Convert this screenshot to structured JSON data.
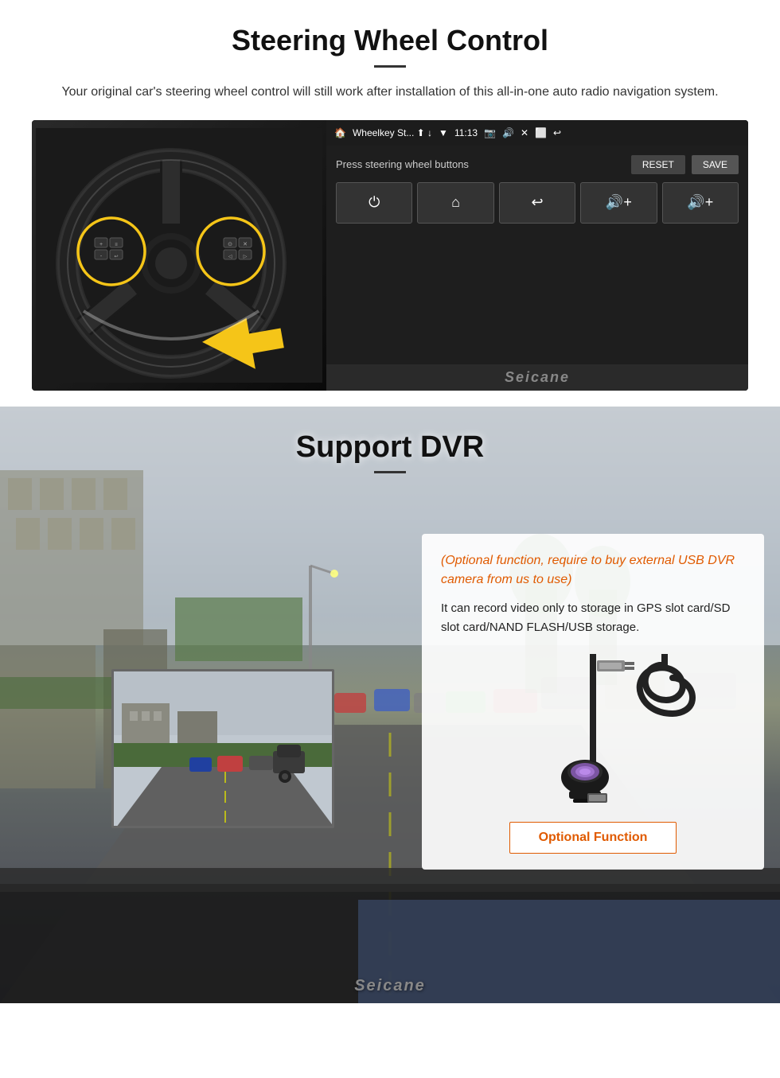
{
  "steering": {
    "title": "Steering Wheel Control",
    "subtitle": "Your original car's steering wheel control will still work after installation of this all-in-one auto radio navigation system.",
    "statusBar": {
      "appName": "Wheelkey St... ⬆ ↓",
      "time": "11:13",
      "icons": "📷 🔊 ✕ ⬜ ↩"
    },
    "wheelkeyUI": {
      "label": "Press steering wheel buttons",
      "resetBtn": "RESET",
      "saveBtn": "SAVE",
      "controls": [
        "⏻",
        "⌂",
        "↩",
        "🔊+",
        "🔊+"
      ]
    },
    "watermark": "Seicane"
  },
  "dvr": {
    "title": "Support DVR",
    "optionalText": "(Optional function, require to buy external USB DVR camera from us to use)",
    "bodyText": "It can record video only to storage in GPS slot card/SD slot card/NAND FLASH/USB storage.",
    "optionalFunctionBtn": "Optional Function",
    "watermark": "Seicane"
  }
}
